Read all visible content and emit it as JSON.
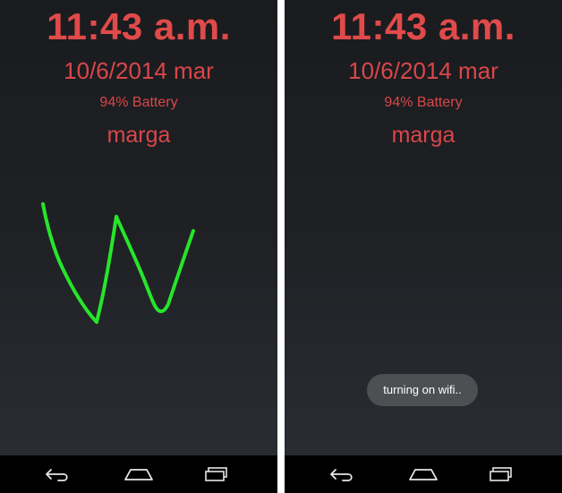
{
  "screens": [
    {
      "time": "11:43 a.m.",
      "date": "10/6/2014 mar",
      "battery": "94% Battery",
      "owner": "marga",
      "gesture": {
        "letter": "W",
        "stroke_color": "#27e52a"
      }
    },
    {
      "time": "11:43 a.m.",
      "date": "10/6/2014 mar",
      "battery": "94% Battery",
      "owner": "marga",
      "toast": "turning on wifi.."
    }
  ],
  "navbar": {
    "buttons": [
      "back-icon",
      "home-icon",
      "recents-icon"
    ]
  },
  "colors": {
    "text_accent": "#e04a4a",
    "gesture_stroke": "#27e52a",
    "toast_bg": "#4d4f52",
    "navbar_bg": "#000000"
  }
}
